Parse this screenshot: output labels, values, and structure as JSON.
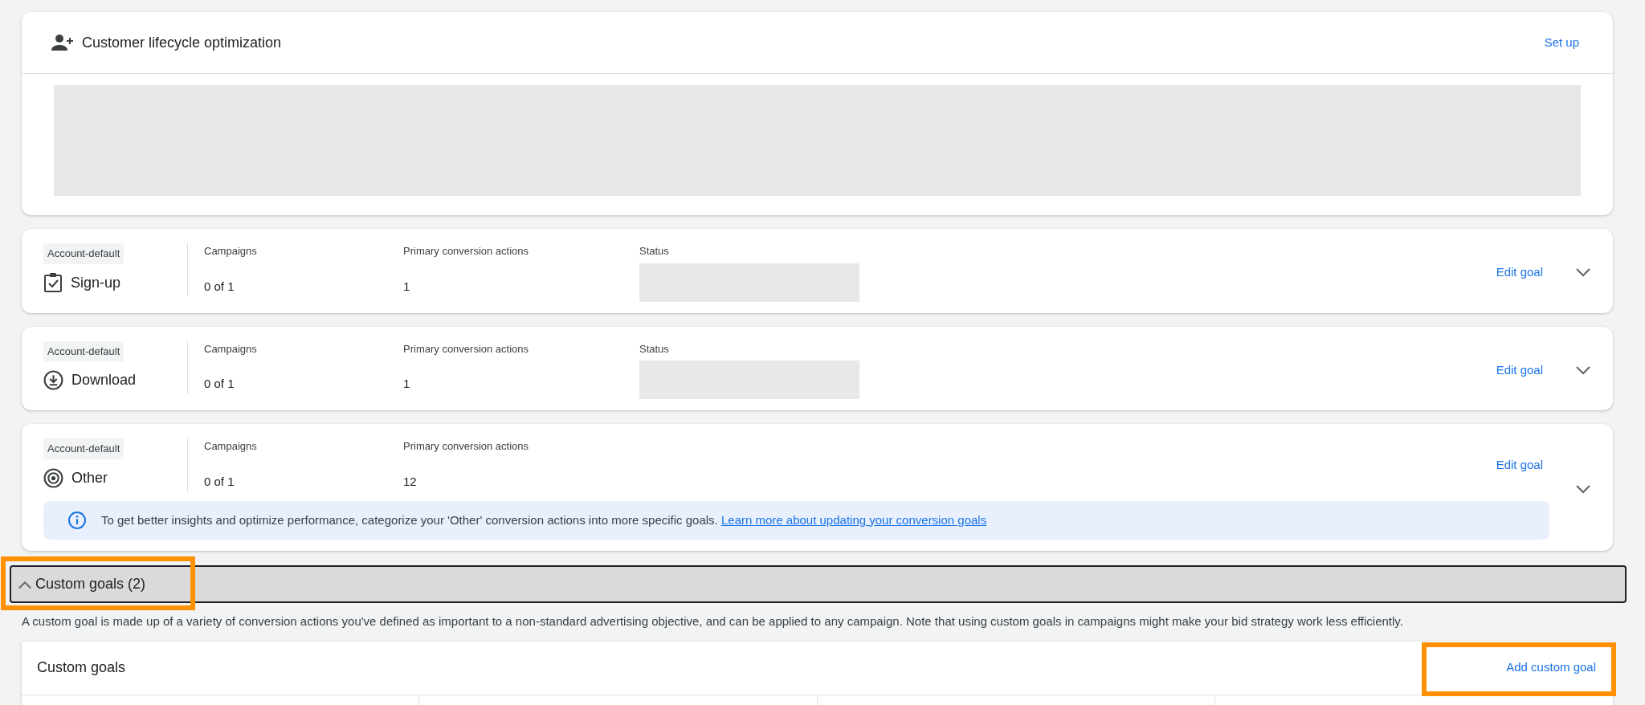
{
  "lifecycle_card": {
    "title": "Customer lifecycle optimization",
    "action": "Set up"
  },
  "goals": [
    {
      "badge": "Account-default",
      "name": "Sign-up",
      "kind": "signup",
      "campaigns_label": "Campaigns",
      "campaigns": "0 of 1",
      "primary_label": "Primary conversion actions",
      "primary": "1",
      "status_label": "Status",
      "edit": "Edit goal",
      "expanded": false
    },
    {
      "badge": "Account-default",
      "name": "Download",
      "kind": "download",
      "campaigns_label": "Campaigns",
      "campaigns": "0 of 1",
      "primary_label": "Primary conversion actions",
      "primary": "1",
      "status_label": "Status",
      "edit": "Edit goal",
      "expanded": false
    },
    {
      "badge": "Account-default",
      "name": "Other",
      "kind": "other",
      "campaigns_label": "Campaigns",
      "campaigns": "0 of 1",
      "primary_label": "Primary conversion actions",
      "primary": "12",
      "edit": "Edit goal",
      "expanded": false,
      "notice": {
        "text": "To get better insights and optimize performance, categorize your 'Other' conversion actions into more specific goals.",
        "link": "Learn more about updating your conversion goals"
      }
    }
  ],
  "custom_section": {
    "label": "Custom goals (2)",
    "expanded": true,
    "highlighted": true,
    "description": "A custom goal is made up of a variety of conversion actions you've defined as important to a non-standard advertising objective, and can be applied to any campaign. Note that using custom goals in campaigns might make your bid strategy work less efficiently."
  },
  "custom_card": {
    "title": "Custom goals",
    "action": "Add custom goal",
    "action_highlighted": true
  }
}
